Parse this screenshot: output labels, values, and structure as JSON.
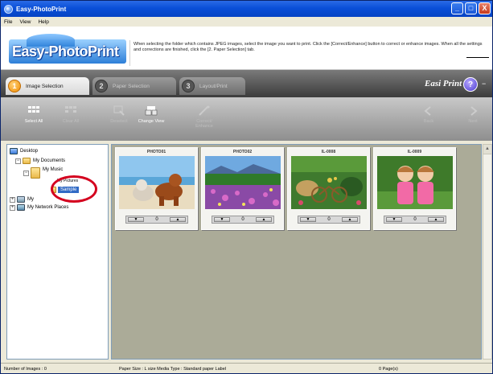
{
  "window": {
    "title": "Easy-PhotoPrint",
    "controls": [
      "_",
      "□",
      "X"
    ]
  },
  "menu": [
    "File",
    "View",
    "Help"
  ],
  "banner": {
    "logo": "Easy-PhotoPrint",
    "message": "When selecting the folder which contains JPEG images, select the image you want to print. Click the [Correct/Enhance] button to correct or enhance images. When all the settings and corrections are finished, click the [2. Paper Selection] tab."
  },
  "tabs": [
    {
      "num": "1",
      "label": "Image Selection",
      "active": true
    },
    {
      "num": "2",
      "label": "Paper Selection",
      "active": false
    },
    {
      "num": "3",
      "label": "Layout/Print",
      "active": false
    }
  ],
  "brand": "Easi Print",
  "help": "?",
  "toolbar": {
    "select_all": "Select All",
    "clear_all": "Clear All",
    "deselect": "Deselect",
    "change_view": "Change View",
    "correct_enhance": "Correct/ Enhance",
    "back": "Back",
    "next": "Next"
  },
  "tree": {
    "desktop": "Desktop",
    "my_documents": "My Documents",
    "my_music": "My Music",
    "my_pictures": "My Pictures",
    "sample": "Sample",
    "my_computer": "My",
    "my_network": "My Network Places"
  },
  "thumbnails": [
    {
      "name": "PHOTO01",
      "count": "0",
      "scene": "beach-dogs"
    },
    {
      "name": "PHOTO02",
      "count": "0",
      "scene": "flower-field"
    },
    {
      "name": "IL-0008",
      "count": "0",
      "scene": "garden-bicycle"
    },
    {
      "name": "IL-0009",
      "count": "0",
      "scene": "two-girls"
    }
  ],
  "status": {
    "images": "Number of Images : 0",
    "paper": "Paper Size : L size  Media Type : Standard paper Label",
    "pages": "0 Page(s)"
  },
  "colors": {
    "title_bar": "#0a4fd8",
    "accent_orange": "#f08c00",
    "highlight": "#316ac5",
    "annotation_red": "#d4001e"
  }
}
